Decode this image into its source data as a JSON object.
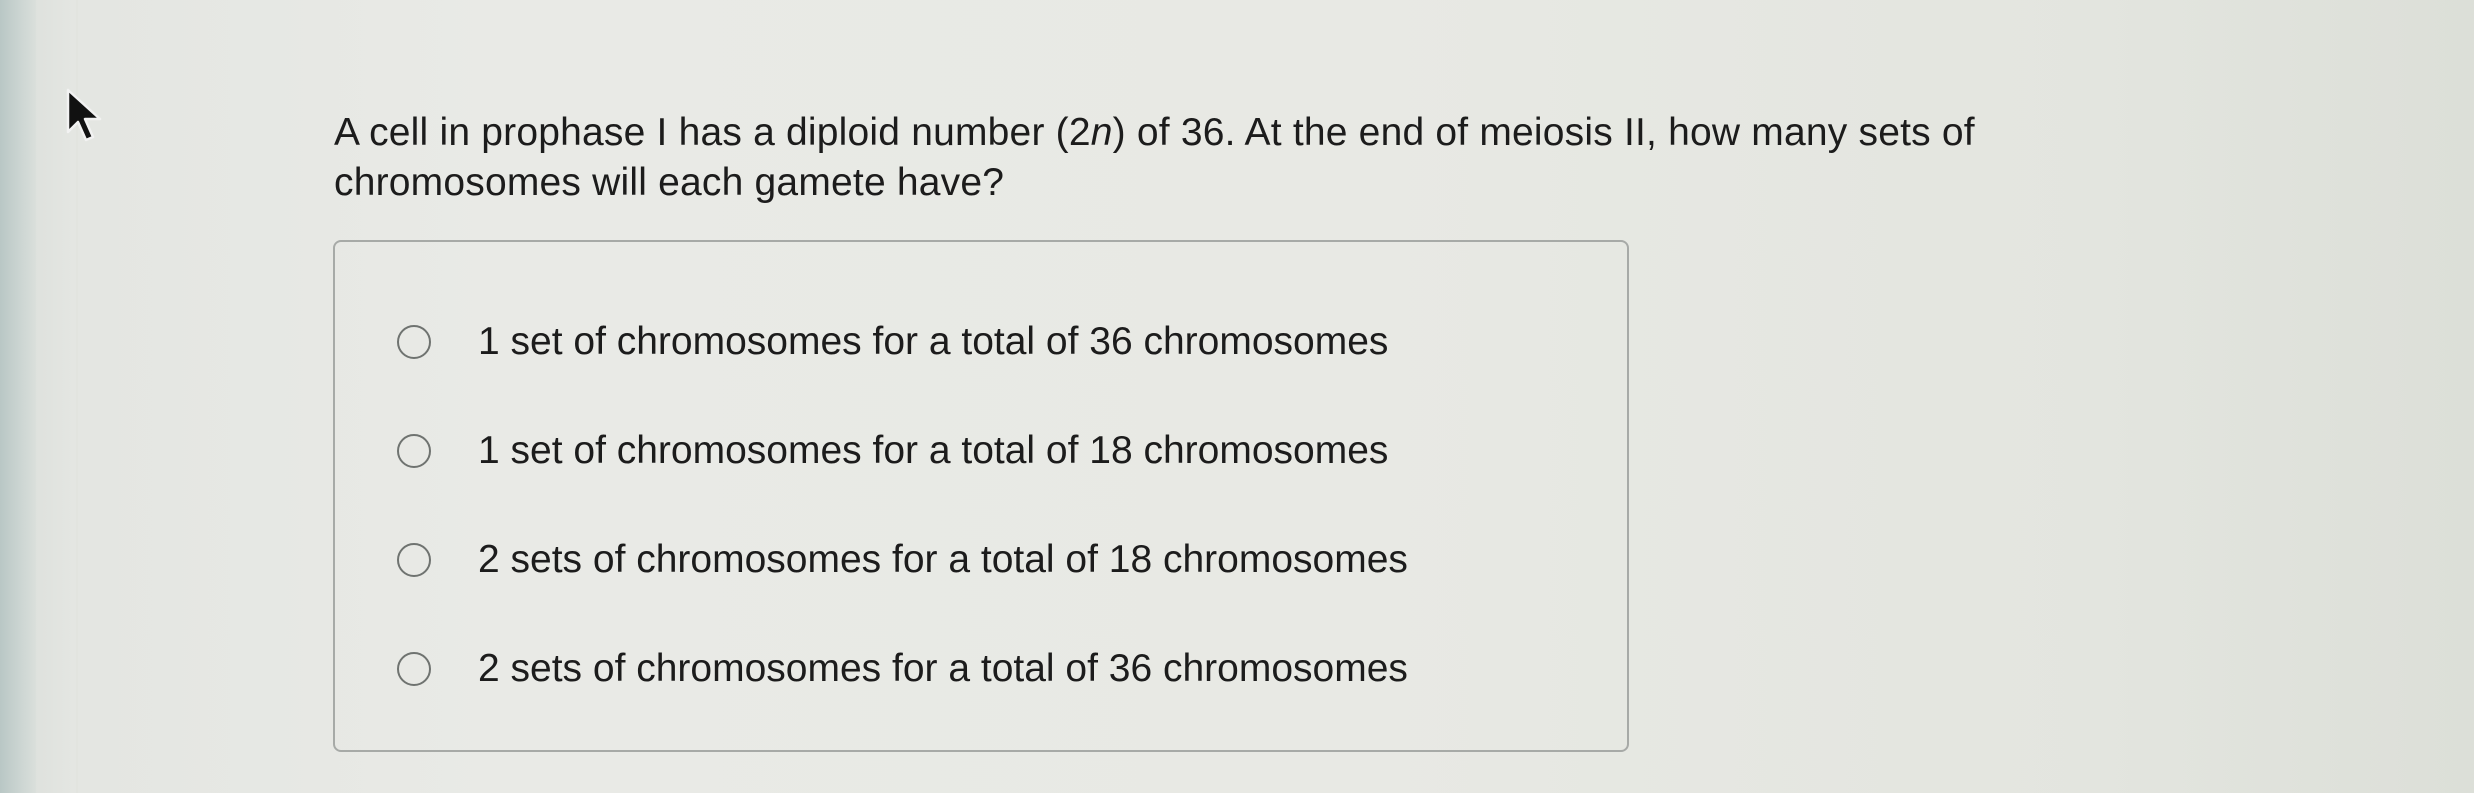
{
  "question": {
    "text_before": "A cell in prophase I has a diploid number (2",
    "variable": "n",
    "text_after_line1": ") of 36. At the end of meiosis II, how many sets of",
    "line2": "chromosomes will each gamete have?"
  },
  "options": [
    {
      "label": "1 set of chromosomes for a total of 36 chromosomes",
      "selected": false
    },
    {
      "label": "1 set of chromosomes for a total of 18 chromosomes",
      "selected": false
    },
    {
      "label": "2 sets of chromosomes for a total of 18 chromosomes",
      "selected": false
    },
    {
      "label": "2 sets of chromosomes for a total of 36 chromosomes",
      "selected": false
    }
  ],
  "cursor": {
    "icon": "mouse-pointer-icon"
  }
}
